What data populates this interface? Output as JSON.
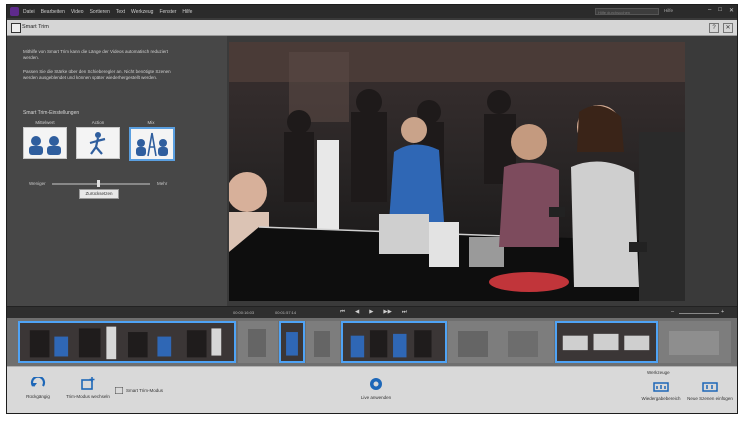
{
  "menu": {
    "items": [
      "Datei",
      "Bearbeiten",
      "Video",
      "Sortieren",
      "Text",
      "Werkzeug",
      "Fenster",
      "Hilfe"
    ],
    "search_placeholder": "Hilfe durchsuchen",
    "help_link": "Hilfe"
  },
  "window": {
    "title": "Smart Trim"
  },
  "left_panel": {
    "paragraph1": "Mithilfe von Smart Trim kann die Länge der Videos automatisch reduziert werden.",
    "paragraph2": "Passen Sie die Stärke über den Schieberegler an. Nicht benötigte Szenen werden ausgeblendet und können später wiederhergestellt werden.",
    "section_title": "Smart Trim-Einstellungen",
    "options": [
      {
        "label": "Mittelwert"
      },
      {
        "label": "Action"
      },
      {
        "label": "Mix"
      }
    ],
    "slider_min": "Weniger",
    "slider_max": "Mehr",
    "slider_level": 0.5,
    "reset_label": "Zurücksetzen"
  },
  "playback": {
    "time_current": "00:00:16:03",
    "time_total": "00:01:57:14",
    "buttons": [
      "⏮",
      "◀",
      "▶",
      "▶▶",
      "⏭"
    ]
  },
  "timeline": {
    "clips": [
      {
        "kind": "active"
      },
      {
        "kind": "dim"
      },
      {
        "kind": "active"
      },
      {
        "kind": "dim"
      },
      {
        "kind": "active"
      },
      {
        "kind": "dim"
      },
      {
        "kind": "active"
      },
      {
        "kind": "dim"
      }
    ]
  },
  "toolbar": {
    "undo_label": "Rückgängig",
    "new_label": "Trim-Modus wechseln",
    "smart_label": "Smart Trim-Modus",
    "apply_label": "Live anwenden",
    "tools_label": "Werkzeuge",
    "right1_label": "Wiedergabebereich",
    "right2_label": "Neue Szenen einfügen"
  },
  "colors": {
    "accent": "#4fa3f5"
  }
}
